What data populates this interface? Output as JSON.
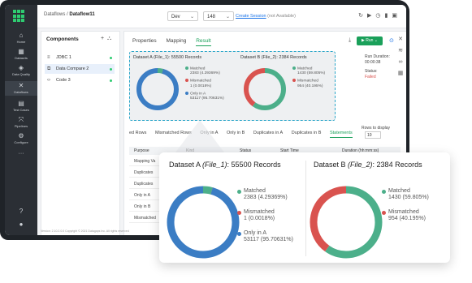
{
  "colors": {
    "matched": "#4caf8a",
    "mismatched": "#d9534f",
    "only": "#3b7dc4",
    "accent": "#1aa05a",
    "link": "#1a73e8"
  },
  "rail": {
    "items": [
      {
        "label": "Home",
        "icon": "home-icon"
      },
      {
        "label": "Datasets",
        "icon": "datasets-icon"
      },
      {
        "label": "Data Quality",
        "icon": "data-quality-icon"
      },
      {
        "label": "Dataflows",
        "icon": "dataflows-icon"
      },
      {
        "label": "Test Cases",
        "icon": "test-cases-icon"
      },
      {
        "label": "Pipelines",
        "icon": "pipelines-icon"
      },
      {
        "label": "Configure",
        "icon": "configure-icon"
      }
    ]
  },
  "topbar": {
    "breadcrumb_root": "Dataflows / ",
    "breadcrumb_current": "Dataflow11",
    "env_select": "Dev",
    "version_select": "148",
    "create_session": "Create Session",
    "create_session_note": "(not Available)"
  },
  "components": {
    "title": "Components",
    "items": [
      {
        "label": "JDBC 1",
        "icon": "database-icon"
      },
      {
        "label": "Data Compare 2",
        "icon": "compare-icon"
      },
      {
        "label": "Code 3",
        "icon": "code-icon"
      }
    ]
  },
  "main": {
    "tabs": [
      "Properties",
      "Mapping",
      "Result"
    ],
    "run_label": "Run",
    "run_duration_label": "Run Duration:",
    "run_duration": "00:00:38",
    "status_label": "Status:",
    "status": "Failed",
    "lower_tabs": [
      "ed Rows",
      "Mismatched Rows",
      "Only in A",
      "Only in B",
      "Duplicates in A",
      "Duplicates in B",
      "Statements"
    ],
    "rows_label": "Rows to display",
    "rows_value": "10",
    "table_headers": [
      "Purpose",
      "Kind",
      "Status",
      "Start Time",
      "Duration (hh:mm:ss)"
    ],
    "table_rows": [
      "Mapping Va",
      "Duplicates",
      "Duplicates",
      "Only in A",
      "Only in B",
      "Mismatched"
    ],
    "footer": "Version: 2.10.2.0.0       Copyright © 2021 Datagaps Inc. All rights reserved"
  },
  "dataset_a": {
    "title_prefix": "Dataset A ",
    "title_file": "(File_1)",
    "title_suffix": ": 55500 Records",
    "matched_label": "Matched",
    "matched_value": "2383 (4.29369%)",
    "mismatched_label": "Mismatched",
    "mismatched_value": "1 (0.0018%)",
    "only_label": "Only in A",
    "only_value": "53117 (95.70631%)",
    "mini_mismatched_value": "1 (0.0018%)",
    "mini_only_value": "53117 (95.70631%)",
    "fractions": {
      "matched": 0.0429369,
      "mismatched": 1.8e-05,
      "only": 0.9570631
    }
  },
  "dataset_b": {
    "title_prefix": "Dataset B ",
    "title_file": "(File_2)",
    "title_suffix": ": 2384 Records",
    "matched_label": "Matched",
    "matched_value": "1430 (59.805%)",
    "mismatched_label": "Mismatched",
    "mismatched_value": "954 (40.195%)",
    "fractions": {
      "matched": 0.59805,
      "mismatched": 0.40195
    }
  }
}
